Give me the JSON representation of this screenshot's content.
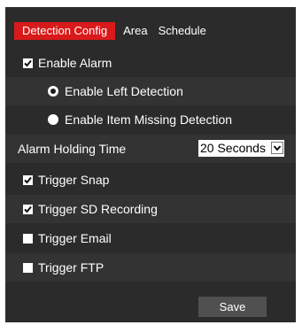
{
  "tabs": [
    {
      "label": "Detection Config",
      "active": true
    },
    {
      "label": "Area",
      "active": false
    },
    {
      "label": "Schedule",
      "active": false
    }
  ],
  "options": {
    "enable_alarm": {
      "label": "Enable Alarm",
      "checked": true
    },
    "enable_left_detection": {
      "label": "Enable Left Detection",
      "selected": true
    },
    "enable_item_missing_detection": {
      "label": "Enable Item Missing Detection",
      "selected": false
    },
    "alarm_holding_time": {
      "label": "Alarm Holding Time",
      "value": "20 Seconds"
    },
    "trigger_snap": {
      "label": "Trigger Snap",
      "checked": true
    },
    "trigger_sd_recording": {
      "label": "Trigger SD Recording",
      "checked": true
    },
    "trigger_email": {
      "label": "Trigger Email",
      "checked": false
    },
    "trigger_ftp": {
      "label": "Trigger FTP",
      "checked": false
    }
  },
  "save_label": "Save",
  "colors": {
    "panel_bg": "#2b2b2b",
    "alt_row_bg": "#333333",
    "active_tab": "#d91a1a",
    "button_bg": "#505050"
  }
}
